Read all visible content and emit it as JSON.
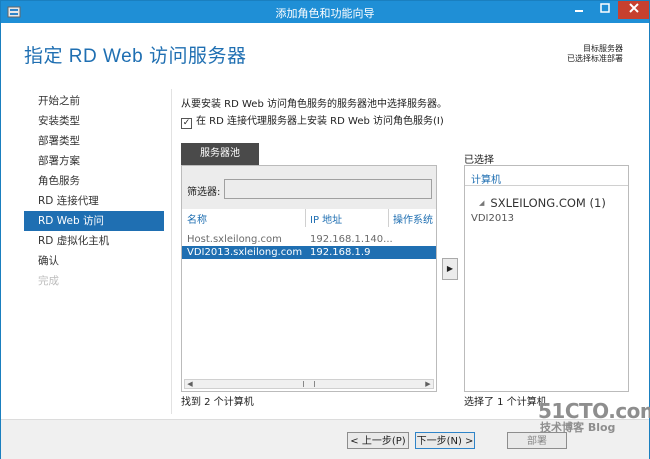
{
  "window": {
    "title": "添加角色和功能向导"
  },
  "header": {
    "title": "指定 RD Web 访问服务器",
    "target_label": "目标服务器",
    "target_value": "已选择标准部署"
  },
  "nav": {
    "items": [
      {
        "label": "开始之前"
      },
      {
        "label": "安装类型"
      },
      {
        "label": "部署类型"
      },
      {
        "label": "部署方案"
      },
      {
        "label": "角色服务"
      },
      {
        "label": "RD 连接代理"
      },
      {
        "label": "RD Web 访问"
      },
      {
        "label": "RD 虚拟化主机"
      },
      {
        "label": "确认"
      },
      {
        "label": "完成"
      }
    ],
    "active_index": 6
  },
  "main": {
    "instruction": "从要安装 RD Web 访问角色服务的服务器池中选择服务器。",
    "checkbox_label": "在 RD 连接代理服务器上安装 RD Web 访问角色服务(I)",
    "checkbox_checked": true,
    "tab_label": "服务器池",
    "filter_label": "筛选器:",
    "filter_value": "",
    "columns": [
      "名称",
      "IP 地址",
      "操作系统"
    ],
    "rows": [
      {
        "name": "Host.sxleilong.com",
        "ip": "192.168.1.140...",
        "os": ""
      },
      {
        "name": "VDI2013.sxleilong.com",
        "ip": "192.168.1.9",
        "os": ""
      }
    ],
    "found_text": "找到 2 个计算机",
    "move_button": "▶"
  },
  "selected": {
    "title": "已选择",
    "column": "计算机",
    "group": "SXLEILONG.COM (1)",
    "items": [
      "VDI2013"
    ],
    "count_text": "选择了 1 个计算机"
  },
  "footer": {
    "prev": "< 上一步(P)",
    "next": "下一步(N) >",
    "deploy": "部署"
  },
  "watermark": {
    "top": "51CTO.com",
    "bottom": "技术博客 Blog"
  },
  "colors": {
    "accent": "#1f6fb2",
    "titlebar": "#1f8fd6",
    "close": "#c7402f"
  }
}
